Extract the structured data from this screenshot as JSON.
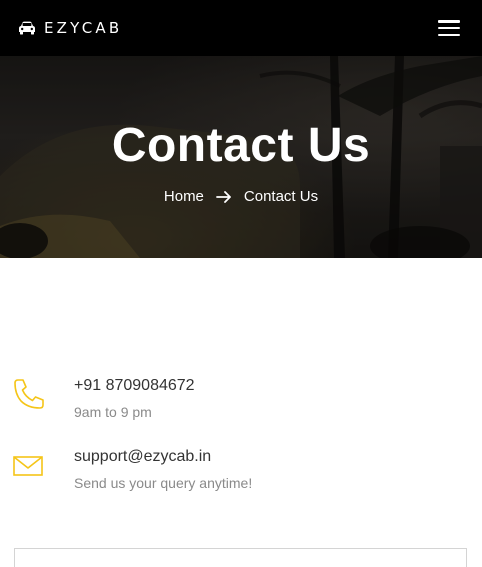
{
  "nav": {
    "brand": "EZYCAB",
    "brand_icon": "car-icon",
    "menu_icon": "hamburger-menu-icon"
  },
  "hero": {
    "title": "Contact Us",
    "breadcrumb": {
      "home": "Home",
      "separator_icon": "arrow-right-icon",
      "current": "Contact Us"
    }
  },
  "contact": {
    "accent_color": "#f5c518",
    "phone": {
      "icon": "phone-icon",
      "value": "+91 8709084672",
      "note": "9am to 9 pm"
    },
    "email": {
      "icon": "mail-icon",
      "value": "support@ezycab.in",
      "note": "Send us your query anytime!"
    }
  }
}
